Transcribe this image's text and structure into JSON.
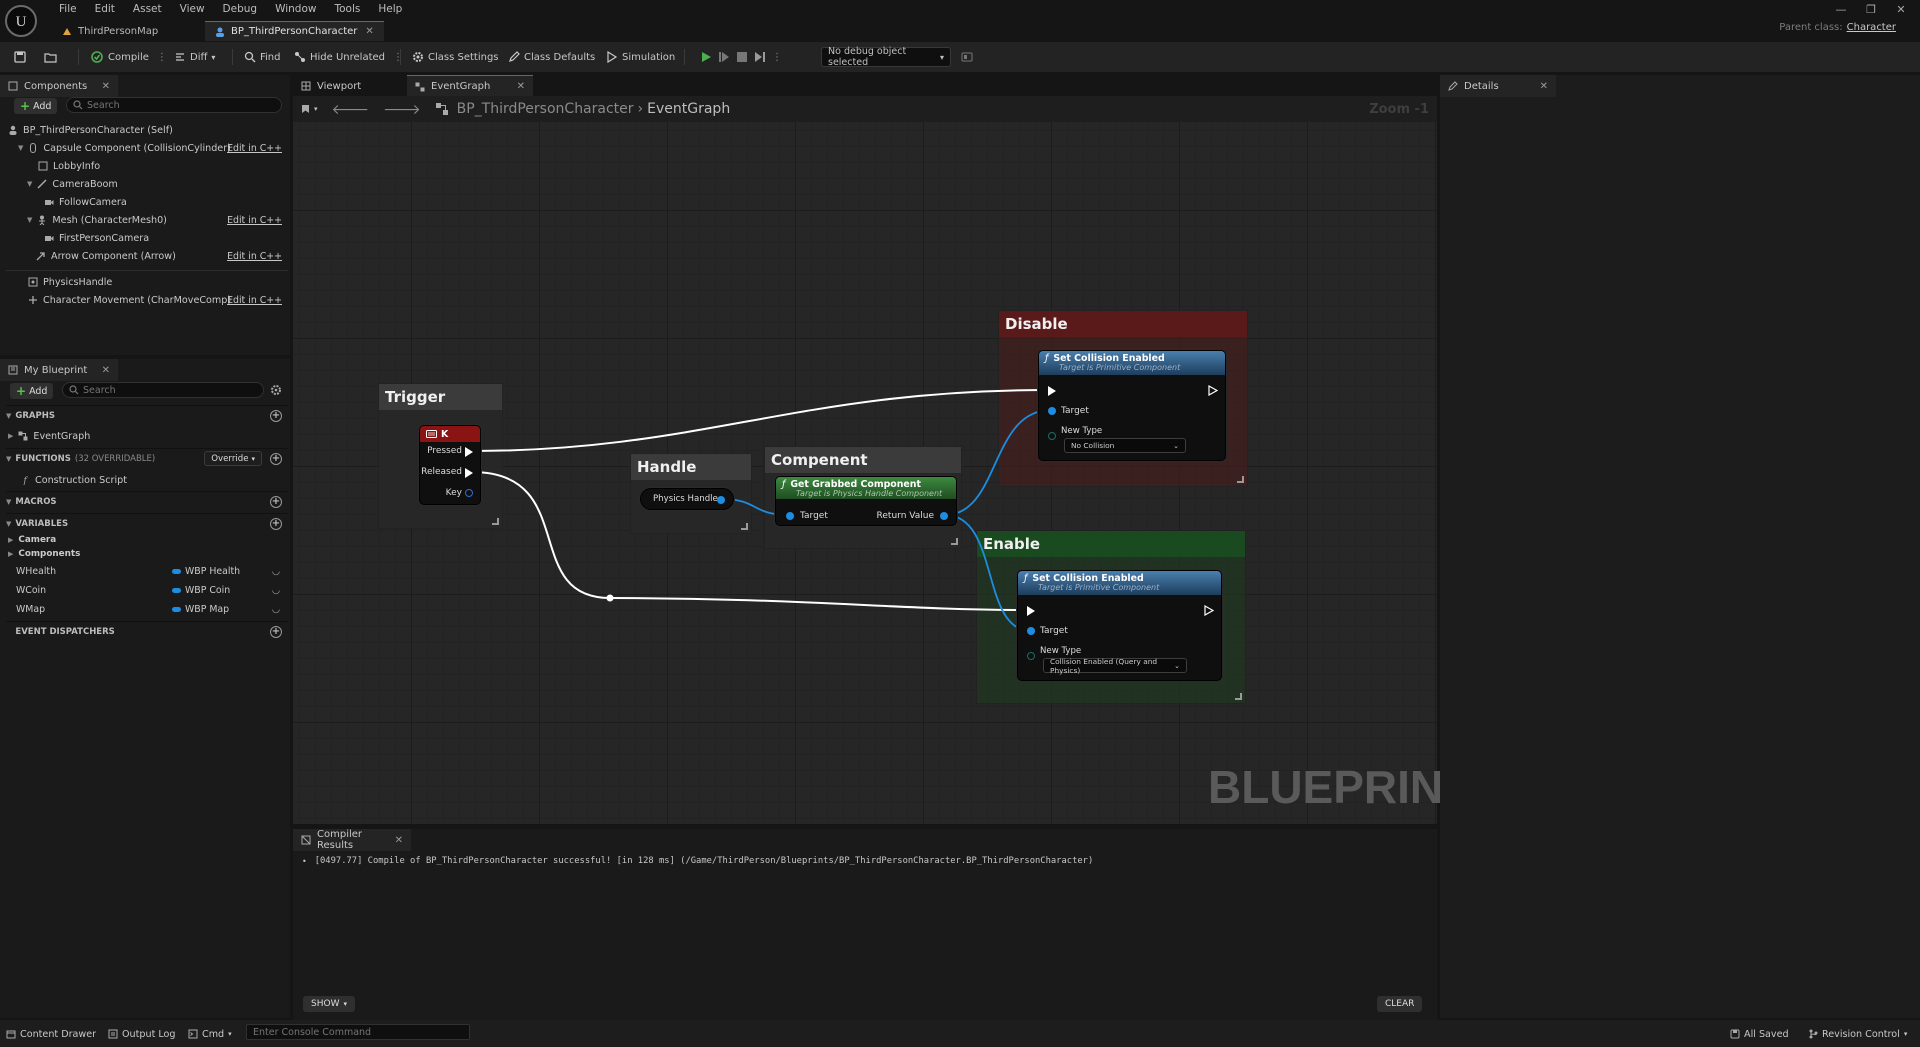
{
  "menu": [
    "File",
    "Edit",
    "Asset",
    "View",
    "Debug",
    "Window",
    "Tools",
    "Help"
  ],
  "doc_tabs": [
    {
      "label": "ThirdPersonMap"
    },
    {
      "label": "BP_ThirdPersonCharacter"
    }
  ],
  "parent_class": {
    "label": "Parent class:",
    "value": "Character"
  },
  "toolbar": {
    "compile": "Compile",
    "diff": "Diff",
    "find": "Find",
    "hide_unrelated": "Hide Unrelated",
    "class_settings": "Class Settings",
    "class_defaults": "Class Defaults",
    "simulation": "Simulation",
    "debug_object": "No debug object selected"
  },
  "components_panel": {
    "tab": "Components",
    "add": "Add",
    "search_placeholder": "Search",
    "items": [
      {
        "label": "BP_ThirdPersonCharacter (Self)",
        "edit": ""
      },
      {
        "label": "Capsule Component (CollisionCylinder)",
        "edit": "Edit in C++"
      },
      {
        "label": "LobbyInfo",
        "edit": ""
      },
      {
        "label": "CameraBoom",
        "edit": ""
      },
      {
        "label": "FollowCamera",
        "edit": ""
      },
      {
        "label": "Mesh (CharacterMesh0)",
        "edit": "Edit in C++"
      },
      {
        "label": "FirstPersonCamera",
        "edit": ""
      },
      {
        "label": "Arrow Component (Arrow)",
        "edit": "Edit in C++"
      },
      {
        "label": "PhysicsHandle",
        "edit": ""
      },
      {
        "label": "Character Movement (CharMoveComp)",
        "edit": "Edit in C++"
      }
    ]
  },
  "my_blueprint": {
    "tab": "My Blueprint",
    "add": "Add",
    "search_placeholder": "Search",
    "graphs_hdr": "GRAPHS",
    "graphs": [
      "EventGraph"
    ],
    "functions_hdr": "FUNCTIONS",
    "functions_count": "(32 OVERRIDABLE)",
    "override": "Override",
    "functions": [
      "Construction Script"
    ],
    "macros_hdr": "MACROS",
    "variables_hdr": "VARIABLES",
    "var_categories": [
      "Camera",
      "Components"
    ],
    "variables": [
      {
        "name": "WHealth",
        "type": "WBP Health"
      },
      {
        "name": "WCoin",
        "type": "WBP Coin"
      },
      {
        "name": "WMap",
        "type": "WBP Map"
      }
    ],
    "dispatchers_hdr": "EVENT DISPATCHERS"
  },
  "center_tabs": [
    "Viewport",
    "EventGraph"
  ],
  "breadcrumb": {
    "root": "BP_ThirdPersonCharacter",
    "leaf": "EventGraph"
  },
  "zoom": "Zoom -1",
  "details_tab": "Details",
  "graph": {
    "watermark": "BLUEPRINT",
    "comments": {
      "trigger": "Trigger",
      "handle": "Handle",
      "compenent": "Compenent",
      "disable": "Disable",
      "enable": "Enable"
    },
    "key_node": {
      "title": "K",
      "pressed": "Pressed",
      "released": "Released",
      "key": "Key"
    },
    "physics_handle_node": {
      "label": "Physics Handle"
    },
    "get_grabbed": {
      "title": "Get Grabbed Component",
      "subtitle": "Target is Physics Handle Component",
      "target": "Target",
      "return": "Return Value"
    },
    "set_disable": {
      "title": "Set Collision Enabled",
      "subtitle": "Target is Primitive Component",
      "target": "Target",
      "new_type": "New Type",
      "value": "No Collision"
    },
    "set_enable": {
      "title": "Set Collision Enabled",
      "subtitle": "Target is Primitive Component",
      "target": "Target",
      "new_type": "New Type",
      "value": "Collision Enabled (Query and Physics)"
    }
  },
  "compiler": {
    "tab": "Compiler Results",
    "log": "[0497.77] Compile of BP_ThirdPersonCharacter successful! [in 128 ms] (/Game/ThirdPerson/Blueprints/BP_ThirdPersonCharacter.BP_ThirdPersonCharacter)",
    "show": "SHOW",
    "clear": "CLEAR"
  },
  "statusbar": {
    "content_drawer": "Content Drawer",
    "output_log": "Output Log",
    "cmd": "Cmd",
    "console_placeholder": "Enter Console Command",
    "all_saved": "All Saved",
    "revision_control": "Revision Control"
  },
  "colors": {
    "accent": "#2f6ed1",
    "pin_blue": "#1c8de0",
    "disable_comment": "#4a1d1d",
    "enable_comment": "#1e3a22",
    "function_header": "#2e5c86",
    "pure_header": "#2f6b33"
  }
}
